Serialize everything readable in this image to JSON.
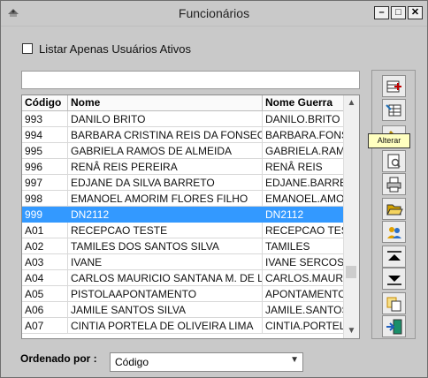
{
  "window": {
    "title": "Funcionários"
  },
  "filters": {
    "active_only_label": "Listar Apenas Usuários Ativos",
    "search_value": ""
  },
  "grid": {
    "columns": [
      "Código",
      "Nome",
      "Nome Guerra"
    ],
    "rows": [
      [
        "993",
        "DANILO BRITO",
        "DANILO.BRITO"
      ],
      [
        "994",
        "BARBARA CRISTINA REIS DA FONSECA",
        "BARBARA.FONS"
      ],
      [
        "995",
        "GABRIELA RAMOS DE ALMEIDA",
        "GABRIELA.RAMO"
      ],
      [
        "996",
        "RENÂ REIS PEREIRA",
        "RENÂ REIS"
      ],
      [
        "997",
        "EDJANE DA SILVA BARRETO",
        "EDJANE.BARRE"
      ],
      [
        "998",
        "EMANOEL AMORIM FLORES FILHO",
        "EMANOEL.AMOR"
      ],
      [
        "999",
        "DN2112",
        "DN2112"
      ],
      [
        "A01",
        "RECEPCAO TESTE",
        "RECEPCAO TEST"
      ],
      [
        "A02",
        "TAMILES DOS SANTOS SILVA",
        "TAMILES"
      ],
      [
        "A03",
        "IVANE",
        "IVANE SERCOSE"
      ],
      [
        "A04",
        "CARLOS MAURICIO SANTANA M. DE LIMA",
        "CARLOS.MAURIC"
      ],
      [
        "A05",
        "PISTOLAAPONTAMENTO",
        "APONTAMENTO"
      ],
      [
        "A06",
        "JAMILE SANTOS SILVA",
        "JAMILE.SANTOS"
      ],
      [
        "A07",
        "CINTIA PORTELA DE OLIVEIRA LIMA",
        "CINTIA.PORTELA"
      ]
    ],
    "selected_index": 6
  },
  "order": {
    "label": "Ordenado por :",
    "value": "Código"
  },
  "toolbar": {
    "tooltip": "Alterar",
    "buttons": [
      {
        "name": "add-icon",
        "color": "#c00000"
      },
      {
        "name": "edit-icon",
        "color": "#1f6fb5"
      },
      {
        "name": "delete-icon",
        "color": "#b08800"
      },
      {
        "name": "preview-icon",
        "color": "#555555"
      },
      {
        "name": "print-icon",
        "color": "#333333"
      },
      {
        "name": "open-folder-icon",
        "color": "#d4a300"
      },
      {
        "name": "users-icon",
        "color": "#e0a000"
      },
      {
        "name": "move-up-icon",
        "color": "#000000"
      },
      {
        "name": "move-down-icon",
        "color": "#000000"
      },
      {
        "name": "copy-icon",
        "color": "#c88a00"
      },
      {
        "name": "exit-icon",
        "color": "#1a8f6a"
      }
    ]
  }
}
